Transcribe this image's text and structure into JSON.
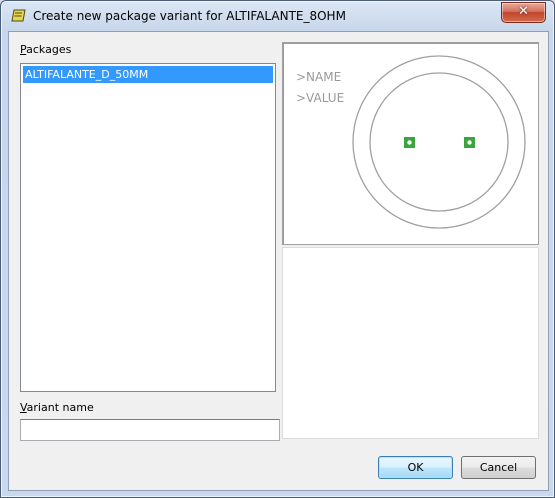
{
  "window": {
    "title": "Create new package variant for ALTIFALANTE_8OHM",
    "close_glyph": "✕"
  },
  "packages": {
    "label_accel": "P",
    "label_rest": "ackages",
    "items": [
      "ALTIFALANTE_D_50MM"
    ],
    "selected_index": 0
  },
  "variant": {
    "label_accel": "V",
    "label_rest": "ariant name",
    "value": ""
  },
  "preview": {
    "name_text": ">NAME",
    "value_text": ">VALUE",
    "outline_color": "#a0a0a0",
    "pad_color": "#3aa53a"
  },
  "buttons": {
    "ok": "OK",
    "cancel": "Cancel"
  }
}
